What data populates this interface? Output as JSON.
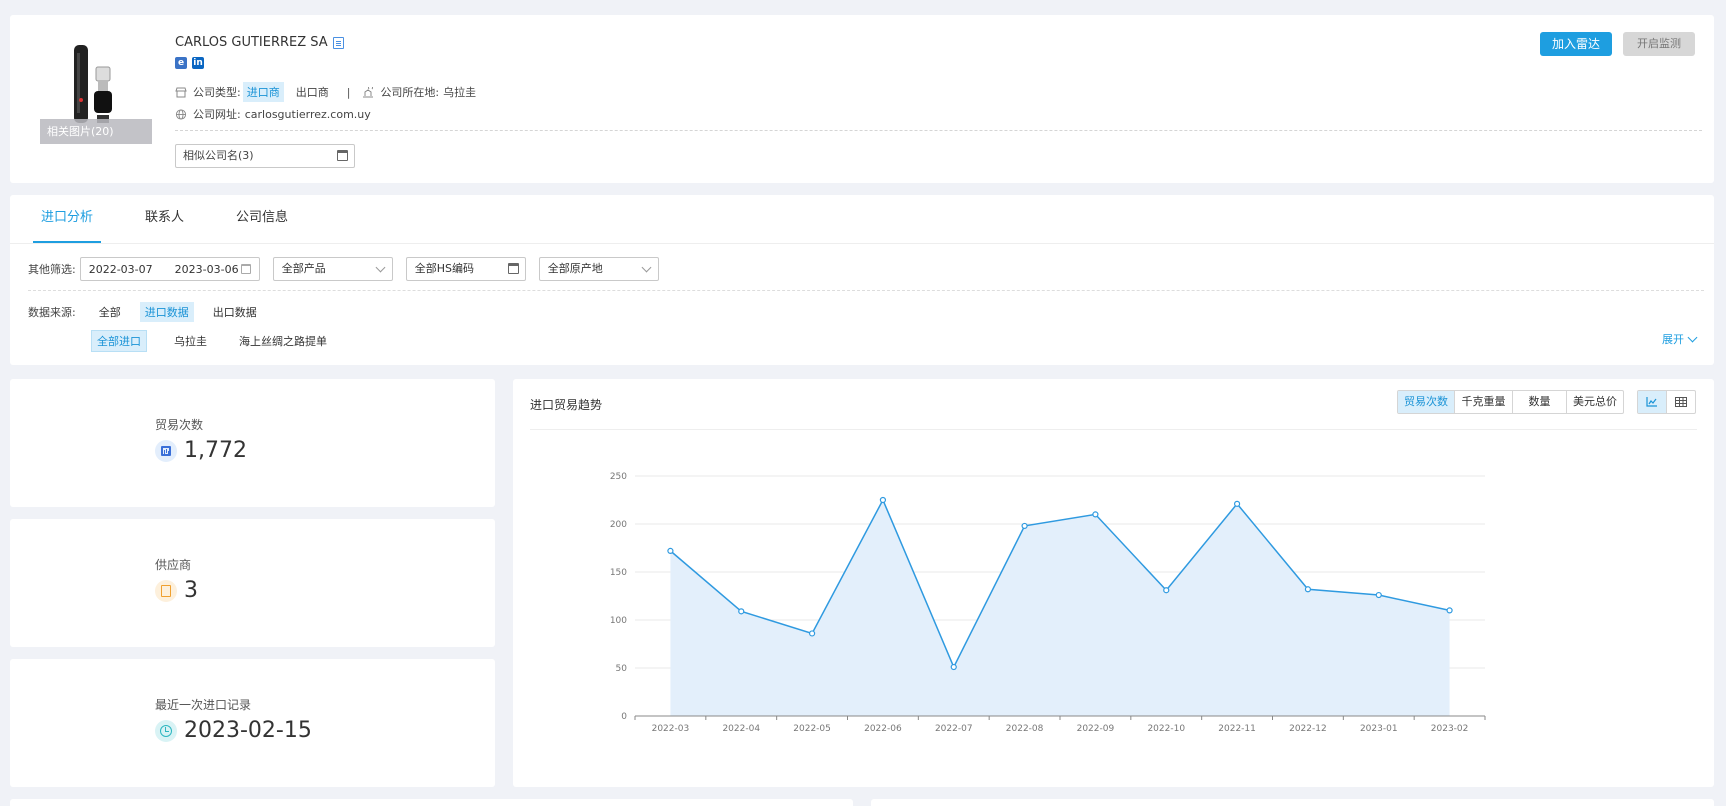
{
  "company": {
    "name": "CARLOS GUTIERREZ SA",
    "photos_label": "相关图片(20)",
    "type_label": "公司类型:",
    "type_active": "进口商",
    "type_other": "出口商",
    "separator": "|",
    "location_label": "公司所在地:",
    "location_value": "乌拉圭",
    "website_label": "公司网址:",
    "website_value": "carlosgutierrez.com.uy",
    "similar_names": "相似公司名(3)",
    "icons": [
      "image-icon",
      "doc-icon",
      "ie-icon",
      "linkedin-icon",
      "store-icon",
      "location-icon",
      "globe-icon",
      "calendar-icon"
    ]
  },
  "actions": {
    "radar": "加入雷达",
    "monitor": "开启监测"
  },
  "tabs": [
    {
      "label": "进口分析"
    },
    {
      "label": "联系人"
    },
    {
      "label": "公司信息"
    }
  ],
  "filters": {
    "label": "其他筛选:",
    "date_start": "2022-03-07",
    "date_end": "2023-03-06",
    "product": "全部产品",
    "hs_code": "全部HS编码",
    "origin": "全部原产地"
  },
  "source": {
    "label": "数据来源:",
    "options": [
      "全部",
      "进口数据",
      "出口数据"
    ],
    "sub_options": [
      "全部进口",
      "乌拉圭",
      "海上丝绸之路提单"
    ],
    "expand": "展开"
  },
  "stats": {
    "trades": {
      "label": "贸易次数",
      "value": "1,772"
    },
    "suppliers": {
      "label": "供应商",
      "value": "3"
    },
    "last_import": {
      "label": "最近一次进口记录",
      "value": "2023-02-15"
    }
  },
  "chart_panel": {
    "title": "进口贸易趋势",
    "metric_tabs": [
      "贸易次数",
      "千克重量",
      "数量",
      "美元总价"
    ],
    "view_icons": [
      "line-chart-icon",
      "table-icon"
    ]
  },
  "colors": {
    "accent": "#1e9ee0",
    "line": "#2f9ae0",
    "area": "#e3effb"
  },
  "chart_data": {
    "type": "area",
    "categories": [
      "2022-03",
      "2022-04",
      "2022-05",
      "2022-06",
      "2022-07",
      "2022-08",
      "2022-09",
      "2022-10",
      "2022-11",
      "2022-12",
      "2023-01",
      "2023-02"
    ],
    "values": [
      172,
      109,
      86,
      225,
      51,
      198,
      210,
      131,
      221,
      132,
      126,
      110
    ],
    "ylim": [
      0,
      250
    ],
    "yticks": [
      0,
      50,
      100,
      150,
      200,
      250
    ],
    "grid": true
  }
}
